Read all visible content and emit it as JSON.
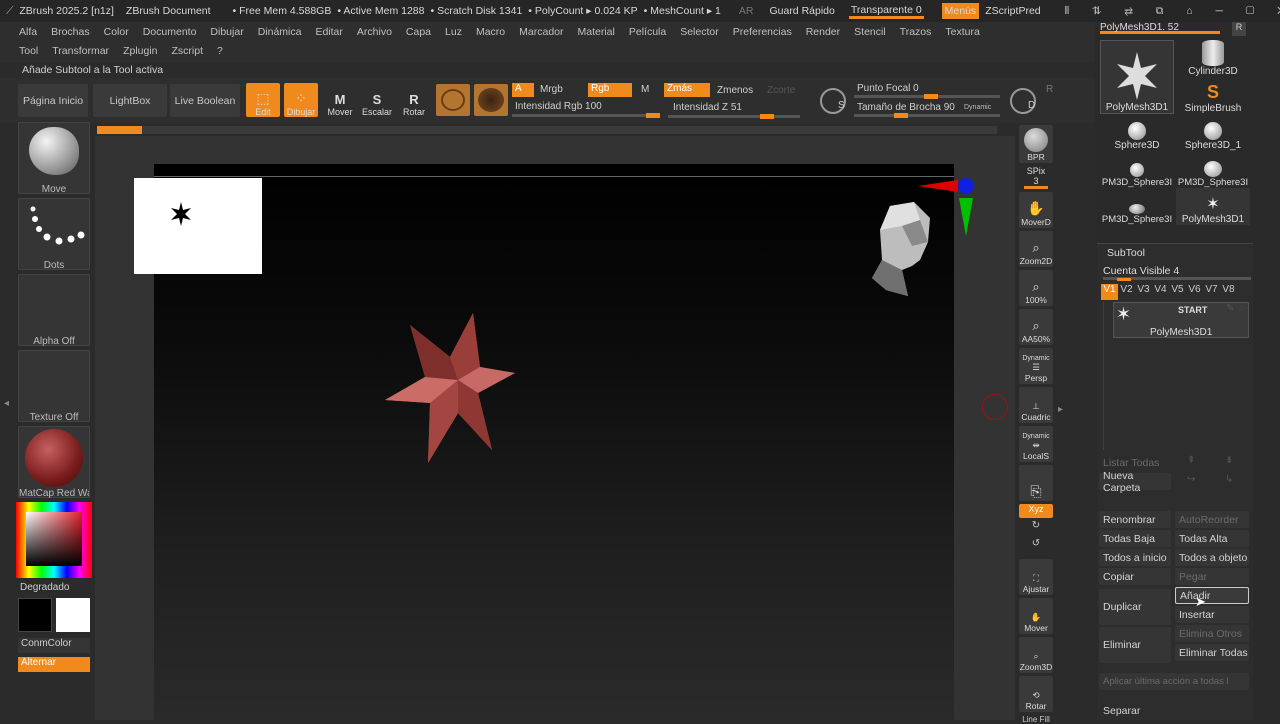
{
  "title": {
    "app": "ZBrush 2025.2 [n1z]",
    "doc": "ZBrush Document",
    "free_mem": "• Free Mem 4.588GB",
    "active_mem": "• Active Mem 1288",
    "scratch": "• Scratch Disk 1341",
    "polycount": "• PolyCount ▸ 0.024 KP",
    "meshcount": "• MeshCount ▸ 1",
    "ar": "AR",
    "guard": "Guard Rápido",
    "transparente": "Transparente 0",
    "menus": "Menús",
    "zscriptpred": "ZScriptPred"
  },
  "menu_row1": [
    "Alfa",
    "Brochas",
    "Color",
    "Documento",
    "Dibujar",
    "Dinámica",
    "Editar",
    "Archivo",
    "Capa",
    "Luz",
    "Macro",
    "Marcador",
    "Material",
    "Película",
    "Selector",
    "Preferencias",
    "Render",
    "Stencil",
    "Trazos",
    "Textura"
  ],
  "menu_row2": [
    "Tool",
    "Transformar",
    "Zplugin",
    "Zscript",
    "?"
  ],
  "info_text": "Añade Subtool a la Tool activa",
  "shelf": {
    "pagina": "Página Inicio",
    "lightbox": "LightBox",
    "liveboolean": "Live Boolean",
    "edit": "Edit",
    "dibujar": "Dibujar",
    "mover": "Mover",
    "escalar": "Escalar",
    "rotar": "Rotar",
    "a": "A",
    "mrgb": "Mrgb",
    "rgb": "Rgb",
    "m": "M",
    "zmas": "Zmás",
    "zmenos": "Zmenos",
    "zcorte": "Zcorte",
    "intensidad_rgb": "Intensidad Rgb 100",
    "intensidad_z": "Intensidad Z 51",
    "punto_focal": "Punto Focal 0",
    "tamano": "Tamaño de Brocha 90",
    "dynamic": "Dynamic",
    "s": "S",
    "d": "D",
    "r": "R"
  },
  "left": {
    "move": "Move",
    "dots": "Dots",
    "alpha": "Alpha Off",
    "texture": "Texture Off",
    "matcap": "MatCap Red Wa",
    "degradado": "Degradado",
    "conmcolor": "ConmColor",
    "alternar": "Alternar"
  },
  "right": {
    "bpr": "BPR",
    "spix": "SPix 3",
    "moverd": "MoverD",
    "zoom2d": "Zoom2D",
    "100": "100%",
    "aa50": "AA50%",
    "dynamic": "Dynamic",
    "persp": "Persp",
    "cuadric": "Cuadric",
    "dynamic2": "Dynamic",
    "locals": "LocalS",
    "xyz": "Xyz",
    "ajustar": "Ajustar",
    "mover": "Mover",
    "zoom3d": "Zoom3D",
    "rotar": "Rotar",
    "linefill": "Line Fill"
  },
  "tools": {
    "header": "PolyMesh3D1. 52",
    "r": "R",
    "t1": "PolyMesh3D1",
    "t2": "Cylinder3D",
    "t3": "SimpleBrush",
    "t4": "Sphere3D",
    "t5": "Sphere3D_1",
    "t6": "PM3D_Sphere3I",
    "t7": "PM3D_Sphere3I",
    "t8": "PM3D_Sphere3I",
    "t9": "PolyMesh3D1"
  },
  "subtool": {
    "header": "SubTool",
    "cuenta": "Cuenta Visible 4",
    "v": [
      "V1",
      "V2",
      "V3",
      "V4",
      "V5",
      "V6",
      "V7",
      "V8"
    ],
    "start": "START",
    "name": "PolyMesh3D1",
    "listar": "Listar Todas",
    "nueva": "Nueva Carpeta",
    "renombrar": "Renombrar",
    "autoreorder": "AutoReorder",
    "todasbaja": "Todas Baja",
    "todasalta": "Todas Alta",
    "todosinicio": "Todos a inicio",
    "todosobj": "Todos a objeto",
    "copiar": "Copiar",
    "pegar": "Pegar",
    "duplicar": "Duplicar",
    "anadir": "Añadir",
    "insertar": "Insertar",
    "eliminar": "Eliminar",
    "eliminarotros": "Elimina Otros",
    "eliminartodas": "Eliminar Todas",
    "aplicar": "Aplicar última acción a todas l",
    "separar": "Separar"
  },
  "colors": {
    "accent": "#f08a1d",
    "star": "#b85450"
  }
}
